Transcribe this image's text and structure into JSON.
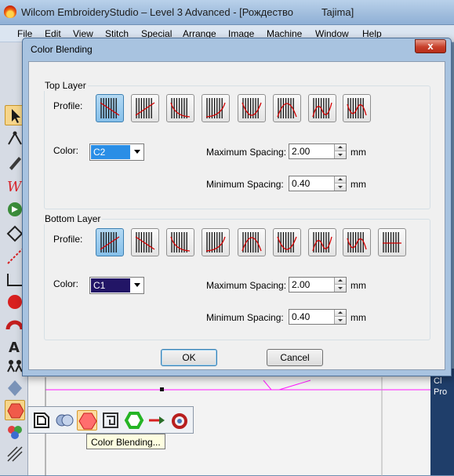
{
  "app": {
    "title": "Wilcom EmbroideryStudio – Level 3 Advanced - [Рождество          Tajima]"
  },
  "menu": [
    "File",
    "Edit",
    "View",
    "Stitch",
    "Special",
    "Arrange",
    "Image",
    "Machine",
    "Window",
    "Help"
  ],
  "dialog": {
    "title": "Color Blending",
    "close_label": "x",
    "top_layer": {
      "title": "Top Layer",
      "profile_label": "Profile:",
      "profiles": [
        "flat-descending",
        "flat-ascending",
        "curve-up",
        "curve-down",
        "arch-down",
        "arch-up",
        "double-wave",
        "inverse-wave"
      ],
      "selected_profile": 0,
      "color_label": "Color:",
      "color_value": "C2",
      "color_hex": "#2a8ee6",
      "max_spacing_label": "Maximum Spacing:",
      "max_spacing_value": "2.00",
      "min_spacing_label": "Minimum Spacing:",
      "min_spacing_value": "0.40",
      "unit": "mm"
    },
    "bottom_layer": {
      "title": "Bottom Layer",
      "profile_label": "Profile:",
      "profiles": [
        "flat-ascending",
        "flat-descending",
        "curve-up",
        "curve-down",
        "arch-up",
        "arch-down",
        "double-wave",
        "inverse-wave",
        "flat-level"
      ],
      "selected_profile": 0,
      "color_label": "Color:",
      "color_value": "C1",
      "color_hex": "#221566",
      "max_spacing_label": "Maximum Spacing:",
      "max_spacing_value": "2.00",
      "min_spacing_label": "Minimum Spacing:",
      "min_spacing_value": "0.40",
      "unit": "mm"
    },
    "ok_label": "OK",
    "cancel_label": "Cancel"
  },
  "flyout": {
    "tools": [
      "outline-tool-icon",
      "overlap-circles-icon",
      "color-blending-icon",
      "pattern-fill-icon",
      "hexagon-outline-icon",
      "arrow-tool-icon",
      "circular-tool-icon"
    ],
    "tooltip": "Color Blending..."
  },
  "right_panel": {
    "labels": [
      "Cl",
      "Pro"
    ]
  }
}
